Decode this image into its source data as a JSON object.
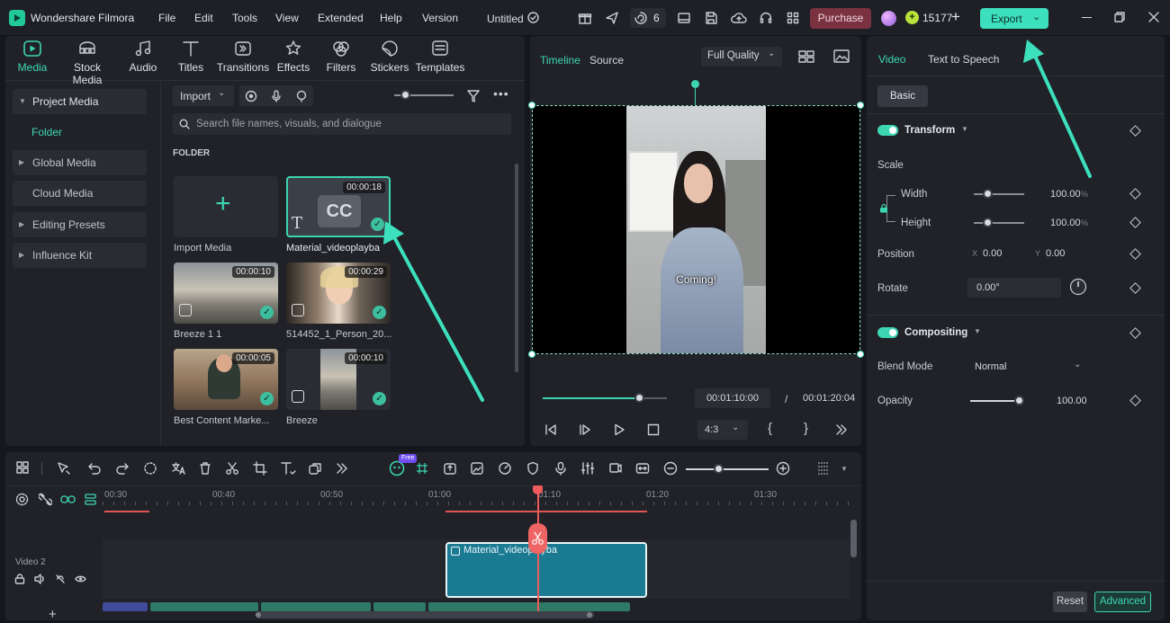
{
  "app": {
    "title": "Wondershare Filmora",
    "project": "Untitled",
    "notif_count": "6",
    "credits": "15177"
  },
  "menu": [
    "File",
    "Edit",
    "Tools",
    "View",
    "Extended",
    "Help",
    "Version"
  ],
  "buttons": {
    "purchase": "Purchase",
    "export": "Export",
    "reset": "Reset",
    "advanced": "Advanced",
    "import": "Import",
    "basic": "Basic"
  },
  "media_tabs": [
    "Media",
    "Stock Media",
    "Audio",
    "Titles",
    "Transitions",
    "Effects",
    "Filters",
    "Stickers",
    "Templates"
  ],
  "sidebar": {
    "items": [
      "Project Media",
      "Folder",
      "Global Media",
      "Cloud Media",
      "Editing Presets",
      "Influence Kit"
    ]
  },
  "search": {
    "placeholder": "Search file names, visuals, and dialogue"
  },
  "folder_label": "FOLDER",
  "media_items": [
    {
      "name": "Import Media",
      "duration": ""
    },
    {
      "name": "Material_videoplayba",
      "duration": "00:00:18"
    },
    {
      "name": "Breeze 1 1",
      "duration": "00:00:10"
    },
    {
      "name": "514452_1_Person_20...",
      "duration": "00:00:29"
    },
    {
      "name": "Best Content Marke...",
      "duration": "00:00:05"
    },
    {
      "name": "Breeze",
      "duration": "00:00:10"
    }
  ],
  "cc_badge": "CC",
  "preview": {
    "tab_timeline": "Timeline",
    "tab_source": "Source",
    "quality": "Full Quality",
    "caption": "Coming!",
    "current_time": "00:01:10:00",
    "separator": "/",
    "total_time": "00:01:20:04",
    "ratio": "4:3",
    "progress": 0.78
  },
  "props": {
    "tab_video": "Video",
    "tab_tts": "Text to Speech",
    "transform": "Transform",
    "scale": "Scale",
    "width": "Width",
    "height": "Height",
    "width_val": "100.00",
    "height_val": "100.00",
    "pct": "%",
    "position": "Position",
    "x_label": "X",
    "x_val": "0.00",
    "y_label": "Y",
    "y_val": "0.00",
    "rotate": "Rotate",
    "rotate_val": "0.00°",
    "compositing": "Compositing",
    "blend_mode": "Blend Mode",
    "blend_val": "Normal",
    "opacity": "Opacity",
    "opacity_val": "100.00"
  },
  "timeline": {
    "ticks": [
      "00:30",
      "00:40",
      "00:50",
      "01:00",
      "01:10",
      "01:20",
      "01:30"
    ],
    "track_label": "Video 2",
    "clip_name": "Material_videoplayba",
    "free_badge": "Free"
  },
  "colors": {
    "accent": "#3dd6b2",
    "purchase": "#7a3140",
    "clip": "#1a7a92",
    "playhead": "#ef5a5a"
  }
}
